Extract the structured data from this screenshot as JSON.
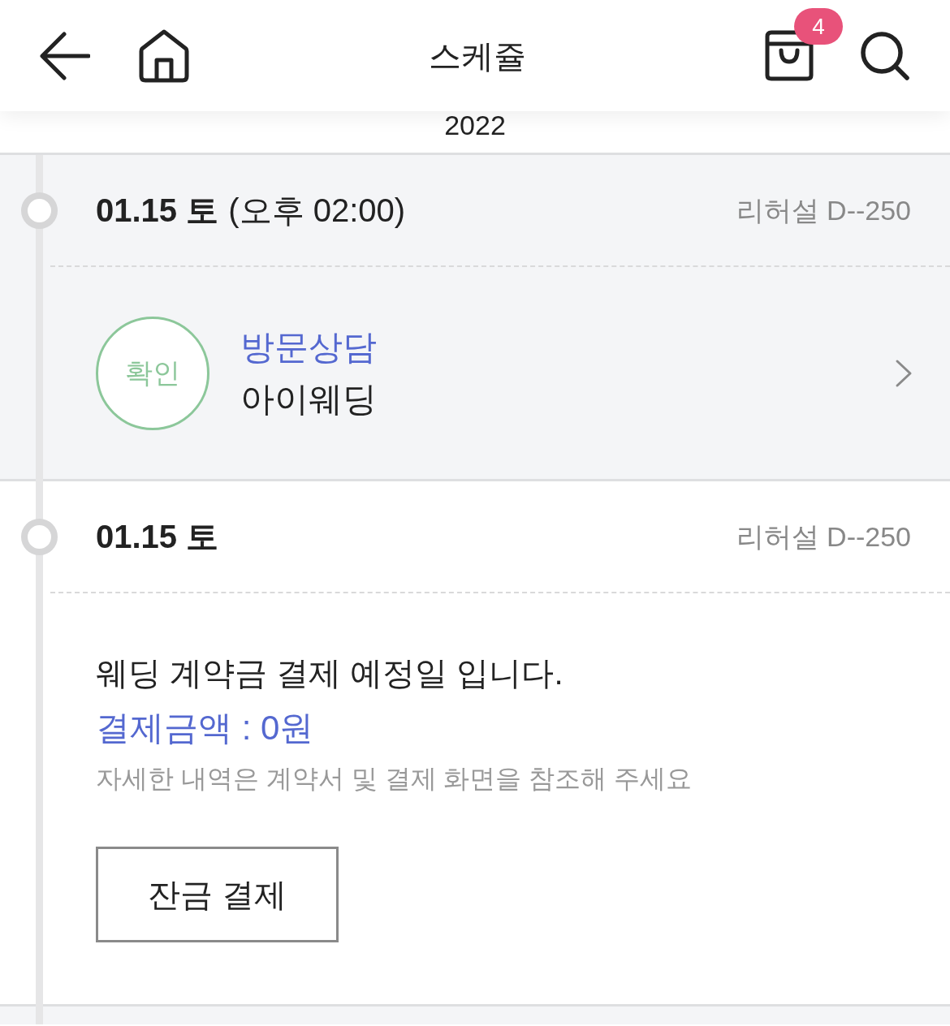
{
  "header": {
    "title": "스케쥴",
    "cart_badge": "4"
  },
  "year": "2022",
  "schedule": [
    {
      "kind": "appointment",
      "date": "01.15 토",
      "time": "(오후 02:00)",
      "d_day": "리허설 D--250",
      "status": "확인",
      "category": "방문상담",
      "vendor": "아이웨딩"
    },
    {
      "kind": "payment",
      "date": "01.15 토",
      "d_day": "리허설 D--250",
      "message": "웨딩 계약금 결제 예정일 입니다.",
      "amount": "결제금액 : 0원",
      "note": "자세한 내역은 계약서 및 결제 화면을 참조해 주세요",
      "button": "잔금 결제"
    }
  ]
}
